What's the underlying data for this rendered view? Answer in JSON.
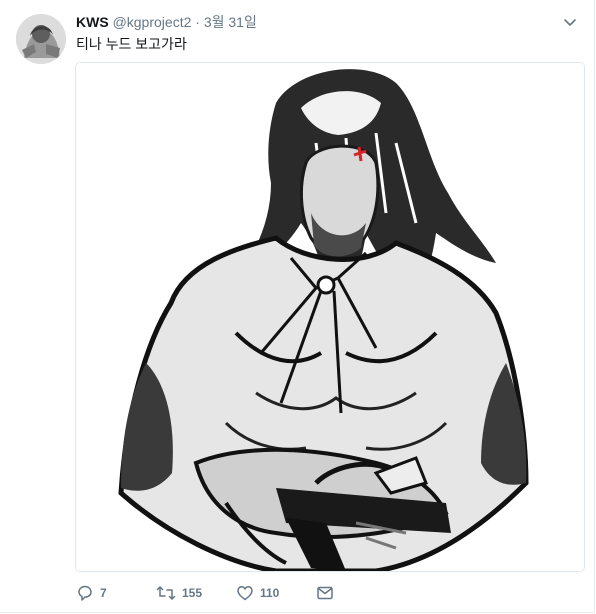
{
  "tweet": {
    "display_name": "KWS",
    "handle": "@kgproject2",
    "separator": "·",
    "date": "3월 31일",
    "text": "티나 누드 보고가라"
  },
  "actions": {
    "reply_count": "7",
    "retweet_count": "155",
    "like_count": "110"
  },
  "icons": {
    "caret": "chevron-down-icon",
    "reply": "reply-icon",
    "retweet": "retweet-icon",
    "like": "heart-icon",
    "message": "envelope-icon"
  },
  "colors": {
    "text": "#14171a",
    "secondary": "#657786",
    "border": "#e1e8ed"
  }
}
